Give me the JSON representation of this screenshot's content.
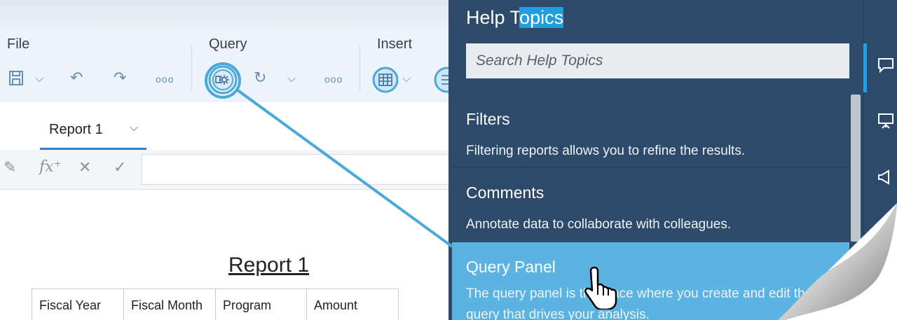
{
  "toolbar": {
    "file_label": "File",
    "query_label": "Query",
    "insert_label": "Insert",
    "more_glyph": "ooo"
  },
  "tabs": [
    {
      "label": "Report 1",
      "active": true
    }
  ],
  "report": {
    "title": "Report 1",
    "columns": [
      "Fiscal Year",
      "Fiscal Month",
      "Program",
      "Amount"
    ]
  },
  "help": {
    "title_pre": "Help T",
    "title_highlight": "opics",
    "search_placeholder": "Search Help Topics",
    "topics": [
      {
        "title": "Filters",
        "desc": "Filtering reports allows you to refine the results."
      },
      {
        "title": "Comments",
        "desc": "Annotate data to collaborate with colleagues."
      },
      {
        "title": "Query Panel",
        "desc": "The query panel is the place where you create and edit the query that drives your analysis."
      }
    ]
  },
  "colors": {
    "help_bg": "#2e4a6a",
    "selected_topic": "#5ab3e0",
    "accent": "#1f9fe0",
    "callout": "#4aa9d8"
  }
}
